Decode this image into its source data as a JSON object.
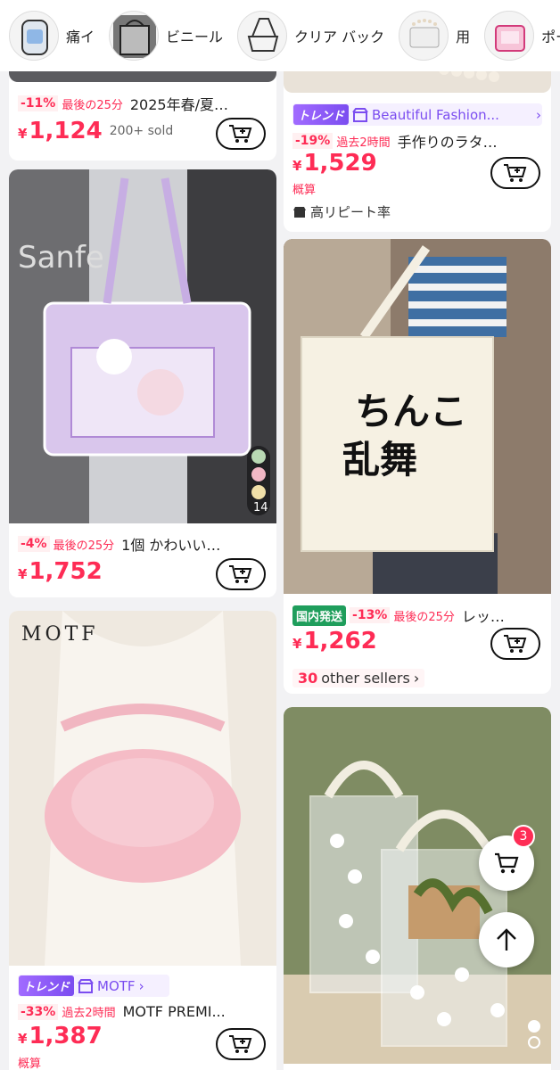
{
  "top_categories": [
    {
      "label": "痛イ",
      "icon": "clear-backpack"
    },
    {
      "label": "ビニール",
      "icon": "vinyl-tote"
    },
    {
      "label": "クリア バック",
      "icon": "clear-shoulder-bag"
    },
    {
      "label": "用",
      "icon": "clear-bag-pearls"
    },
    {
      "label": "ポー",
      "icon": "pink-pouch"
    }
  ],
  "cards": {
    "c1": {
      "discount": "-11%",
      "timer": "最後の25分",
      "title": "2025年春/夏…",
      "price_yen": "¥",
      "price": "1,124",
      "sold": "200+ sold"
    },
    "c2": {
      "trend": "トレンド",
      "store": "Beautiful Fashion...",
      "discount": "-19%",
      "timer": "過去2時間",
      "title": "手作りのラタ…",
      "price_yen": "¥",
      "price": "1,529",
      "approx": "概算",
      "repeat": "高リピート率"
    },
    "c3": {
      "discount": "-4%",
      "timer": "最後の25分",
      "title": "1個 かわいい…",
      "price_yen": "¥",
      "price": "1,752",
      "photo_count": "14",
      "swatches": [
        "#b9d9b4",
        "#f2b8c6",
        "#f0dfa8"
      ]
    },
    "c4": {
      "domestic": "国内発送",
      "discount": "-13%",
      "timer": "最後の25分",
      "title": "レッ…",
      "price_yen": "¥",
      "price": "1,262",
      "sellers_count": "30",
      "sellers_label": "other sellers",
      "tote_text_line1": "ちんこ",
      "tote_text_line2": "乱舞"
    },
    "c5": {
      "brand_mark": "MOTF",
      "trend": "トレンド",
      "store": "MOTF",
      "discount": "-33%",
      "timer": "過去2時間",
      "title": "MOTF PREMI...",
      "price_yen": "¥",
      "price": "1,387",
      "approx": "概算"
    }
  },
  "floating": {
    "cart_count": "3"
  },
  "colors": {
    "accent": "#fe2c55",
    "trend": "#7b4df0",
    "domestic": "#1f9e5c"
  }
}
